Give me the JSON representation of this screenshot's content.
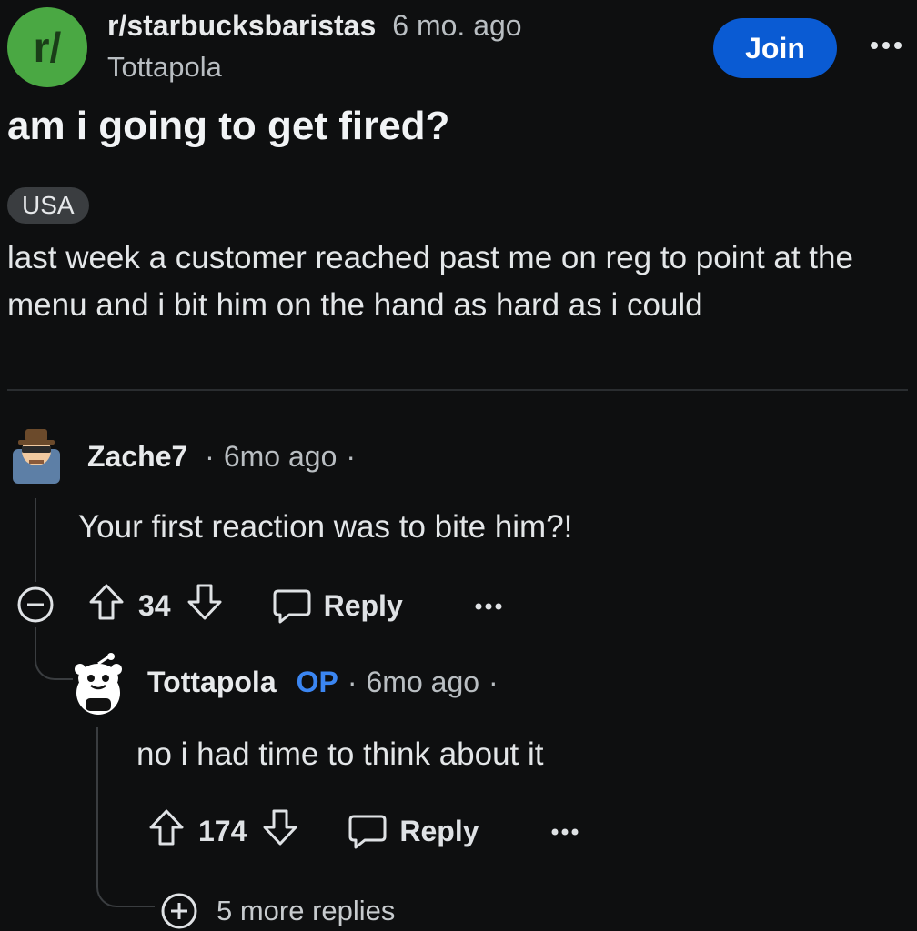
{
  "post": {
    "subreddit_avatar_text": "r/",
    "subreddit": "r/starbucksbaristas",
    "time": "6 mo. ago",
    "author": "Tottapola",
    "join_label": "Join",
    "title": "am i going to get fired?",
    "flair": "USA",
    "body": "last week a customer reached past me on reg to point at the menu and i bit him on the hand as hard as i could"
  },
  "comments": [
    {
      "username": "Zache7",
      "time": "6mo ago",
      "text": "Your first reaction was to bite him?!",
      "votes": "34",
      "reply_label": "Reply"
    },
    {
      "username": "Tottapola",
      "op_badge": "OP",
      "time": "6mo ago",
      "text": "no i had time to think about it",
      "votes": "174",
      "reply_label": "Reply"
    }
  ],
  "more_replies": "5 more replies",
  "colors": {
    "background": "#0e0f10",
    "join_button": "#0a5bd3",
    "subreddit_icon": "#4aa843",
    "op_badge": "#3b86f2"
  },
  "icons": [
    "more-icon",
    "upvote-icon",
    "downvote-icon",
    "comment-icon",
    "collapse-icon",
    "expand-icon"
  ]
}
